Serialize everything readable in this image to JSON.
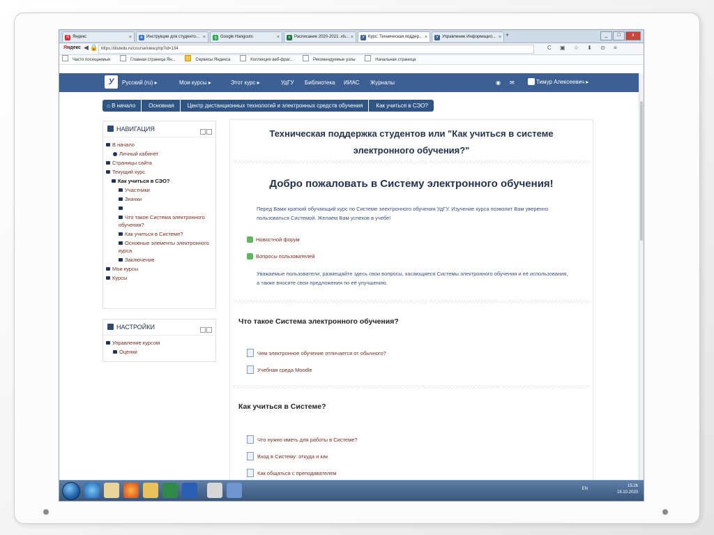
{
  "browser": {
    "tabs": [
      {
        "label": "Яндекс",
        "icon_color": "#e3262b",
        "icon": "Я"
      },
      {
        "label": "Инструкции для студенто...",
        "icon_color": "#3a79c9",
        "icon": "e"
      },
      {
        "label": "Google Hangouts",
        "icon_color": "#2ba24c",
        "icon": "g"
      },
      {
        "label": "Расписание 2020-2021 .xls...",
        "icon_color": "#1e7a3c",
        "icon": "x"
      },
      {
        "label": "Курс: Техническая поддер...",
        "icon_color": "#3c5f94",
        "icon": "У"
      },
      {
        "label": "Управление Информацио...",
        "icon_color": "#3c5f94",
        "icon": "У"
      }
    ],
    "tab_close": "×",
    "new_tab": "+",
    "logo_prefix": "Я",
    "logo_rest": "ндекс",
    "url": "https://distedu.ru/course/view.php?id=134",
    "toolbar_icons": "C ▣ ☆ ⬇ ⊙ ≡",
    "bookmarks": [
      "Часто посещаемые",
      "Главная страница Ян...",
      "Сервисы Яндекса",
      "Коллекция веб-фраг...",
      "Рекомендуемые узлы",
      "Начальная страница"
    ]
  },
  "site_nav": {
    "logo": "У",
    "items": [
      "Русский (ru) ▸",
      "Мои курсы ▸",
      "Этот курс ▸",
      "УдГУ",
      "Библиотека",
      "ИИАС",
      "Журналы"
    ],
    "user": "Тимур Алексеевич ▸"
  },
  "breadcrumbs": [
    "В начало",
    "Основная",
    "Центр дистанционных технологий и электронных средств обучения",
    "Как учиться в СЭО?"
  ],
  "navigation": {
    "title": "НАВИГАЦИЯ",
    "items": [
      {
        "label": "В начало",
        "level": 0
      },
      {
        "label": "Личный кабинет",
        "level": 1
      },
      {
        "label": "Страницы сайта",
        "level": 0
      },
      {
        "label": "Текущий курс",
        "level": 0
      },
      {
        "label": "Как учиться в СЭО?",
        "level": 1,
        "current": true
      },
      {
        "label": "Участники",
        "level": 2
      },
      {
        "label": "Значки",
        "level": 2
      },
      {
        "label": "",
        "level": 2
      },
      {
        "label": "Что такое Система электронного обучения?",
        "level": 2
      },
      {
        "label": "Как учиться в Системе?",
        "level": 2
      },
      {
        "label": "Основные элементы электронного курса",
        "level": 2
      },
      {
        "label": "Заключение",
        "level": 2
      },
      {
        "label": "Мои курсы",
        "level": 0
      },
      {
        "label": "Курсы",
        "level": 0
      }
    ]
  },
  "settings": {
    "title": "НАСТРОЙКИ",
    "items": [
      "Управление курсом",
      "Оценки"
    ]
  },
  "main": {
    "title": "Техническая поддержка студентов или \"Как учиться в системе электронного обучения?\"",
    "welcome": "Добро пожаловать в Систему электронного обучения!",
    "intro": "Перед Вами краткий обучающий курс по Системе электронного обучения УдГУ. Изучение курса позволит Вам уверенно пользоваться Системой. Желаем Вам успехов в учебе!",
    "forum_links": [
      "Новостной форум",
      "Вопросы пользователей"
    ],
    "notice": "Уважаемые пользователи, размещайте здесь свои вопросы, касающиеся Системы электронного обучения и её использования, а также вносите свои предложения по её улучшению.",
    "section1": {
      "title": "Что такое Система электронного обучения?",
      "links": [
        "Чем электронное обучение отличается от обычного?",
        "Учебная среда Moodle"
      ]
    },
    "section2": {
      "title": "Как учиться в Системе?",
      "links": [
        "Что нужно иметь для работы в Системе?",
        "Вход в Систему: откуда и как",
        "Как общаться с преподавателем"
      ]
    }
  },
  "taskbar": {
    "lang": "EN",
    "time": "15:26",
    "date": "19.10.2020"
  },
  "colors": {
    "nav_bar": "#3c5f94",
    "breadcrumb": "#2f5586",
    "link": "#7a2a1f",
    "heading": "#24324f"
  }
}
